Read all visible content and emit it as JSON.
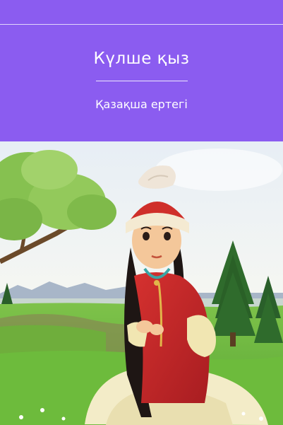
{
  "cover": {
    "title": "Күлше қыз",
    "subtitle": "Қазақша ертегі"
  },
  "colors": {
    "header_background": "#8b5cf0",
    "header_text": "#ffffff"
  }
}
